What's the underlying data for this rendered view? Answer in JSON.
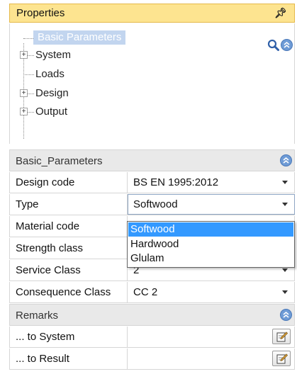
{
  "panel": {
    "title": "Properties",
    "pin_icon": "pin-icon"
  },
  "tree": {
    "items": [
      {
        "label": "Basic Parameters",
        "selected": true,
        "expandable": false
      },
      {
        "label": "System",
        "selected": false,
        "expandable": true
      },
      {
        "label": "Loads",
        "selected": false,
        "expandable": false
      },
      {
        "label": "Design",
        "selected": false,
        "expandable": true
      },
      {
        "label": "Output",
        "selected": false,
        "expandable": true
      }
    ],
    "expander_glyph": "+"
  },
  "basic_parameters": {
    "header": "Basic_Parameters",
    "rows": [
      {
        "name": "Design code",
        "value": "BS EN 1995:2012",
        "dropdown": true
      },
      {
        "name": "Type",
        "value": "Softwood",
        "dropdown": true
      },
      {
        "name": "Material code",
        "value": "",
        "dropdown": true
      },
      {
        "name": "Strength class",
        "value": "",
        "dropdown": true
      },
      {
        "name": "Service Class",
        "value": "2",
        "dropdown": true
      },
      {
        "name": "Consequence Class",
        "value": "CC 2",
        "dropdown": true
      }
    ]
  },
  "type_dropdown": {
    "options": [
      "Softwood",
      "Hardwood",
      "Glulam"
    ],
    "selected": "Softwood"
  },
  "remarks": {
    "header": "Remarks",
    "rows": [
      {
        "name": "... to System",
        "value": ""
      },
      {
        "name": "... to Result",
        "value": ""
      }
    ]
  },
  "colors": {
    "title_bg": "#fde490",
    "selection_bg": "#3399ff",
    "tree_selection_bg": "#c2d5ef",
    "header_bg": "#e9e9e9",
    "collapse_icon": "#6e9bd6"
  }
}
